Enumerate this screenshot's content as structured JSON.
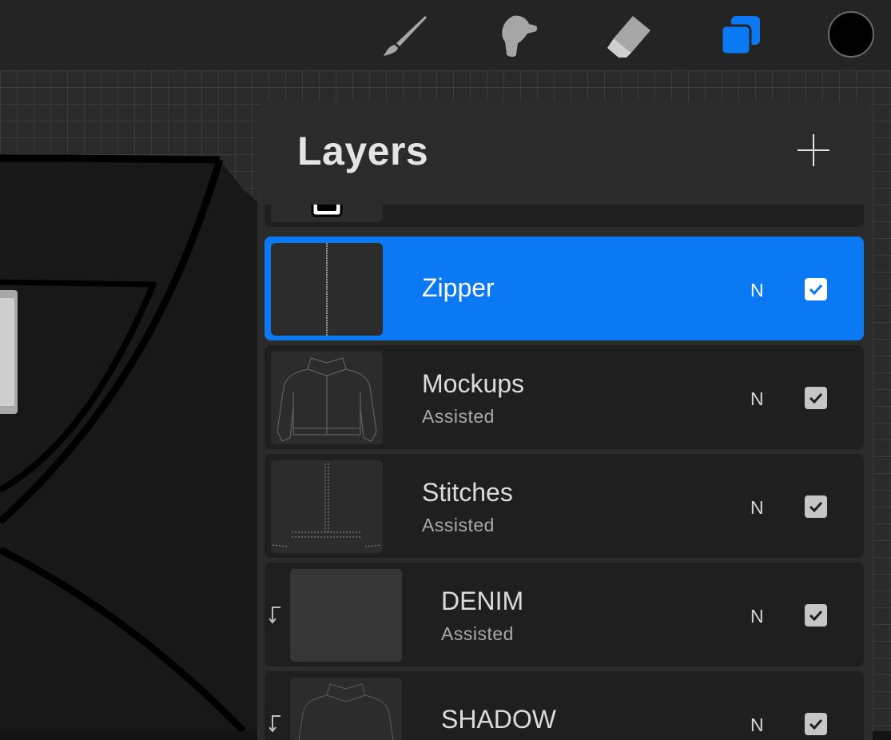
{
  "toolbar": {
    "tools": [
      {
        "name": "brush-icon"
      },
      {
        "name": "smudge-icon"
      },
      {
        "name": "eraser-icon"
      },
      {
        "name": "layers-icon",
        "active": true
      }
    ],
    "current_color": "#000000",
    "accent_color": "#0a79f3"
  },
  "layers_panel": {
    "title": "Layers",
    "add_icon": "plus-icon",
    "layers": [
      {
        "name": "",
        "subtitle": "",
        "blend_mode": "",
        "visible": true,
        "partial": true
      },
      {
        "name": "Zipper",
        "subtitle": "",
        "blend_mode": "N",
        "visible": true,
        "selected": true
      },
      {
        "name": "Mockups",
        "subtitle": "Assisted",
        "blend_mode": "N",
        "visible": true
      },
      {
        "name": "Stitches",
        "subtitle": "Assisted",
        "blend_mode": "N",
        "visible": true
      },
      {
        "name": "DENIM",
        "subtitle": "Assisted",
        "blend_mode": "N",
        "visible": true,
        "clipped": true
      },
      {
        "name": "SHADOW",
        "subtitle": "",
        "blend_mode": "N",
        "visible": true,
        "clipped": true
      }
    ]
  }
}
